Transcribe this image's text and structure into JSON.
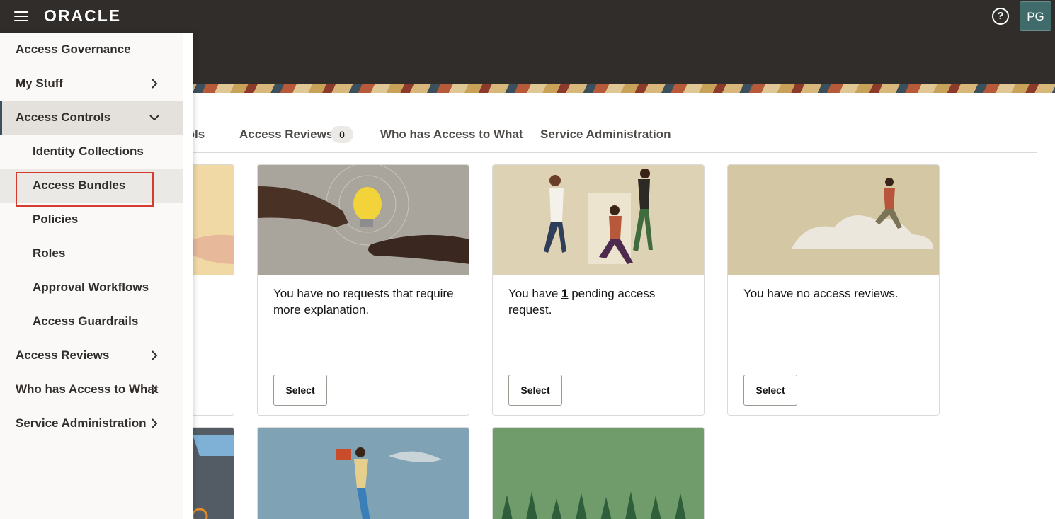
{
  "header": {
    "logo_text": "ORACLE",
    "help_icon": "question-circle-icon",
    "avatar_initials": "PG"
  },
  "tabs": [
    {
      "label": "rols"
    },
    {
      "label": "Access Reviews",
      "badge": "0"
    },
    {
      "label": "Who has Access to What"
    },
    {
      "label": "Service Administration"
    }
  ],
  "cards": [
    {
      "text": "You have no requests that require more explanation.",
      "button": "Select"
    },
    {
      "text_before": "You have ",
      "count": "1",
      "text_after": " pending access request.",
      "button": "Select"
    },
    {
      "text": "You have no access reviews.",
      "button": "Select"
    }
  ],
  "nav": {
    "items": [
      {
        "label": "Access Governance"
      },
      {
        "label": "My Stuff",
        "icon": "chevron-right-icon"
      },
      {
        "label": "Access Controls",
        "icon": "chevron-down-icon"
      },
      {
        "label": "Identity Collections"
      },
      {
        "label": "Access Bundles"
      },
      {
        "label": "Policies"
      },
      {
        "label": "Roles"
      },
      {
        "label": "Approval Workflows"
      },
      {
        "label": "Access Guardrails"
      },
      {
        "label": "Access Reviews",
        "icon": "chevron-right-icon"
      },
      {
        "label": "Who has Access to What",
        "icon": "chevron-right-icon"
      },
      {
        "label": "Service Administration",
        "icon": "chevron-right-icon"
      }
    ]
  },
  "colors": {
    "header_bg": "#312d2a",
    "highlight": "#d63b2f",
    "accent": "#3c4f5c"
  }
}
